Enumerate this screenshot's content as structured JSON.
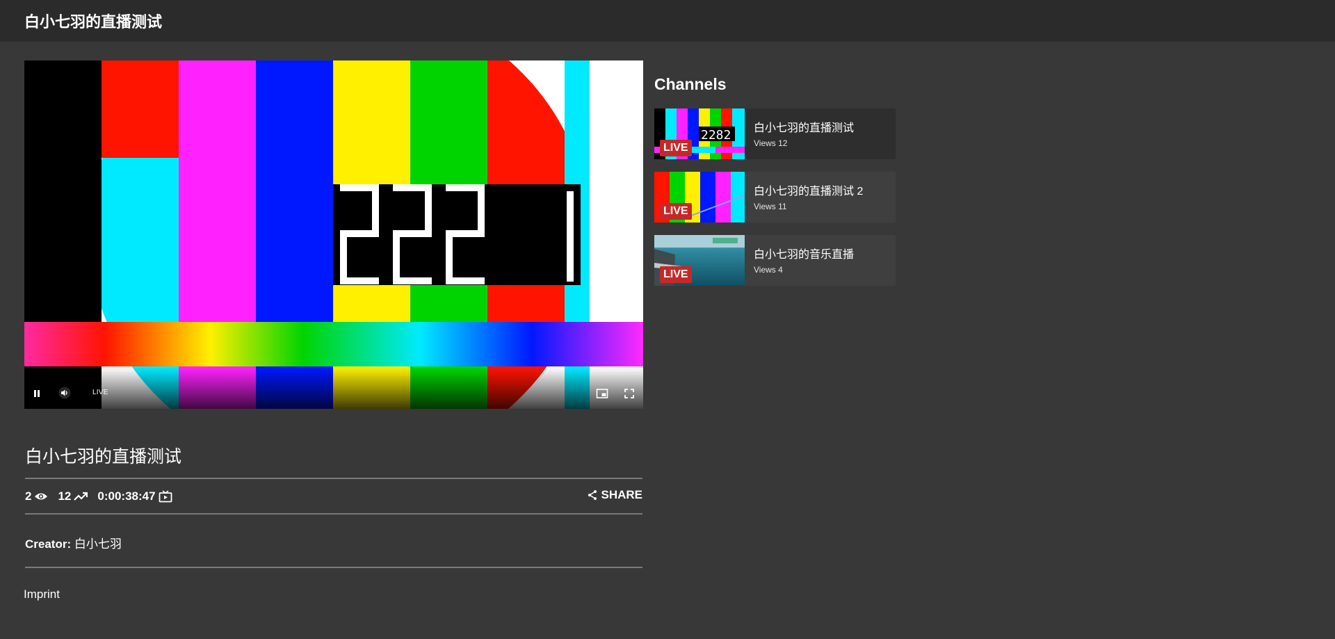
{
  "header": {
    "title": "白小七羽的直播测试"
  },
  "player": {
    "live_label": "LIVE",
    "clock_text": "2221",
    "icons": [
      "pause-icon",
      "volume-icon",
      "picture-in-picture-icon",
      "fullscreen-icon"
    ]
  },
  "sidebar": {
    "heading": "Channels",
    "channels": [
      {
        "title": "白小七羽的直播测试",
        "views": "Views 12",
        "badge": "LIVE",
        "thumb": "test-pattern"
      },
      {
        "title": "白小七羽的直播测试 2",
        "views": "Views 11",
        "badge": "LIVE",
        "thumb": "color-bars"
      },
      {
        "title": "白小七羽的音乐直播",
        "views": "Views 4",
        "badge": "LIVE",
        "thumb": "ocean-deck"
      }
    ]
  },
  "stream": {
    "title": "白小七羽的直播测试",
    "viewers": "2",
    "total_views": "12",
    "uptime": "0:00:38:47",
    "share_label": "SHARE",
    "creator_label": "Creator:",
    "creator_name": "白小七羽"
  },
  "footer": {
    "imprint": "Imprint"
  },
  "colors": {
    "background": "#383838",
    "topbar": "#2b2b2b",
    "live_badge": "#c62828"
  }
}
